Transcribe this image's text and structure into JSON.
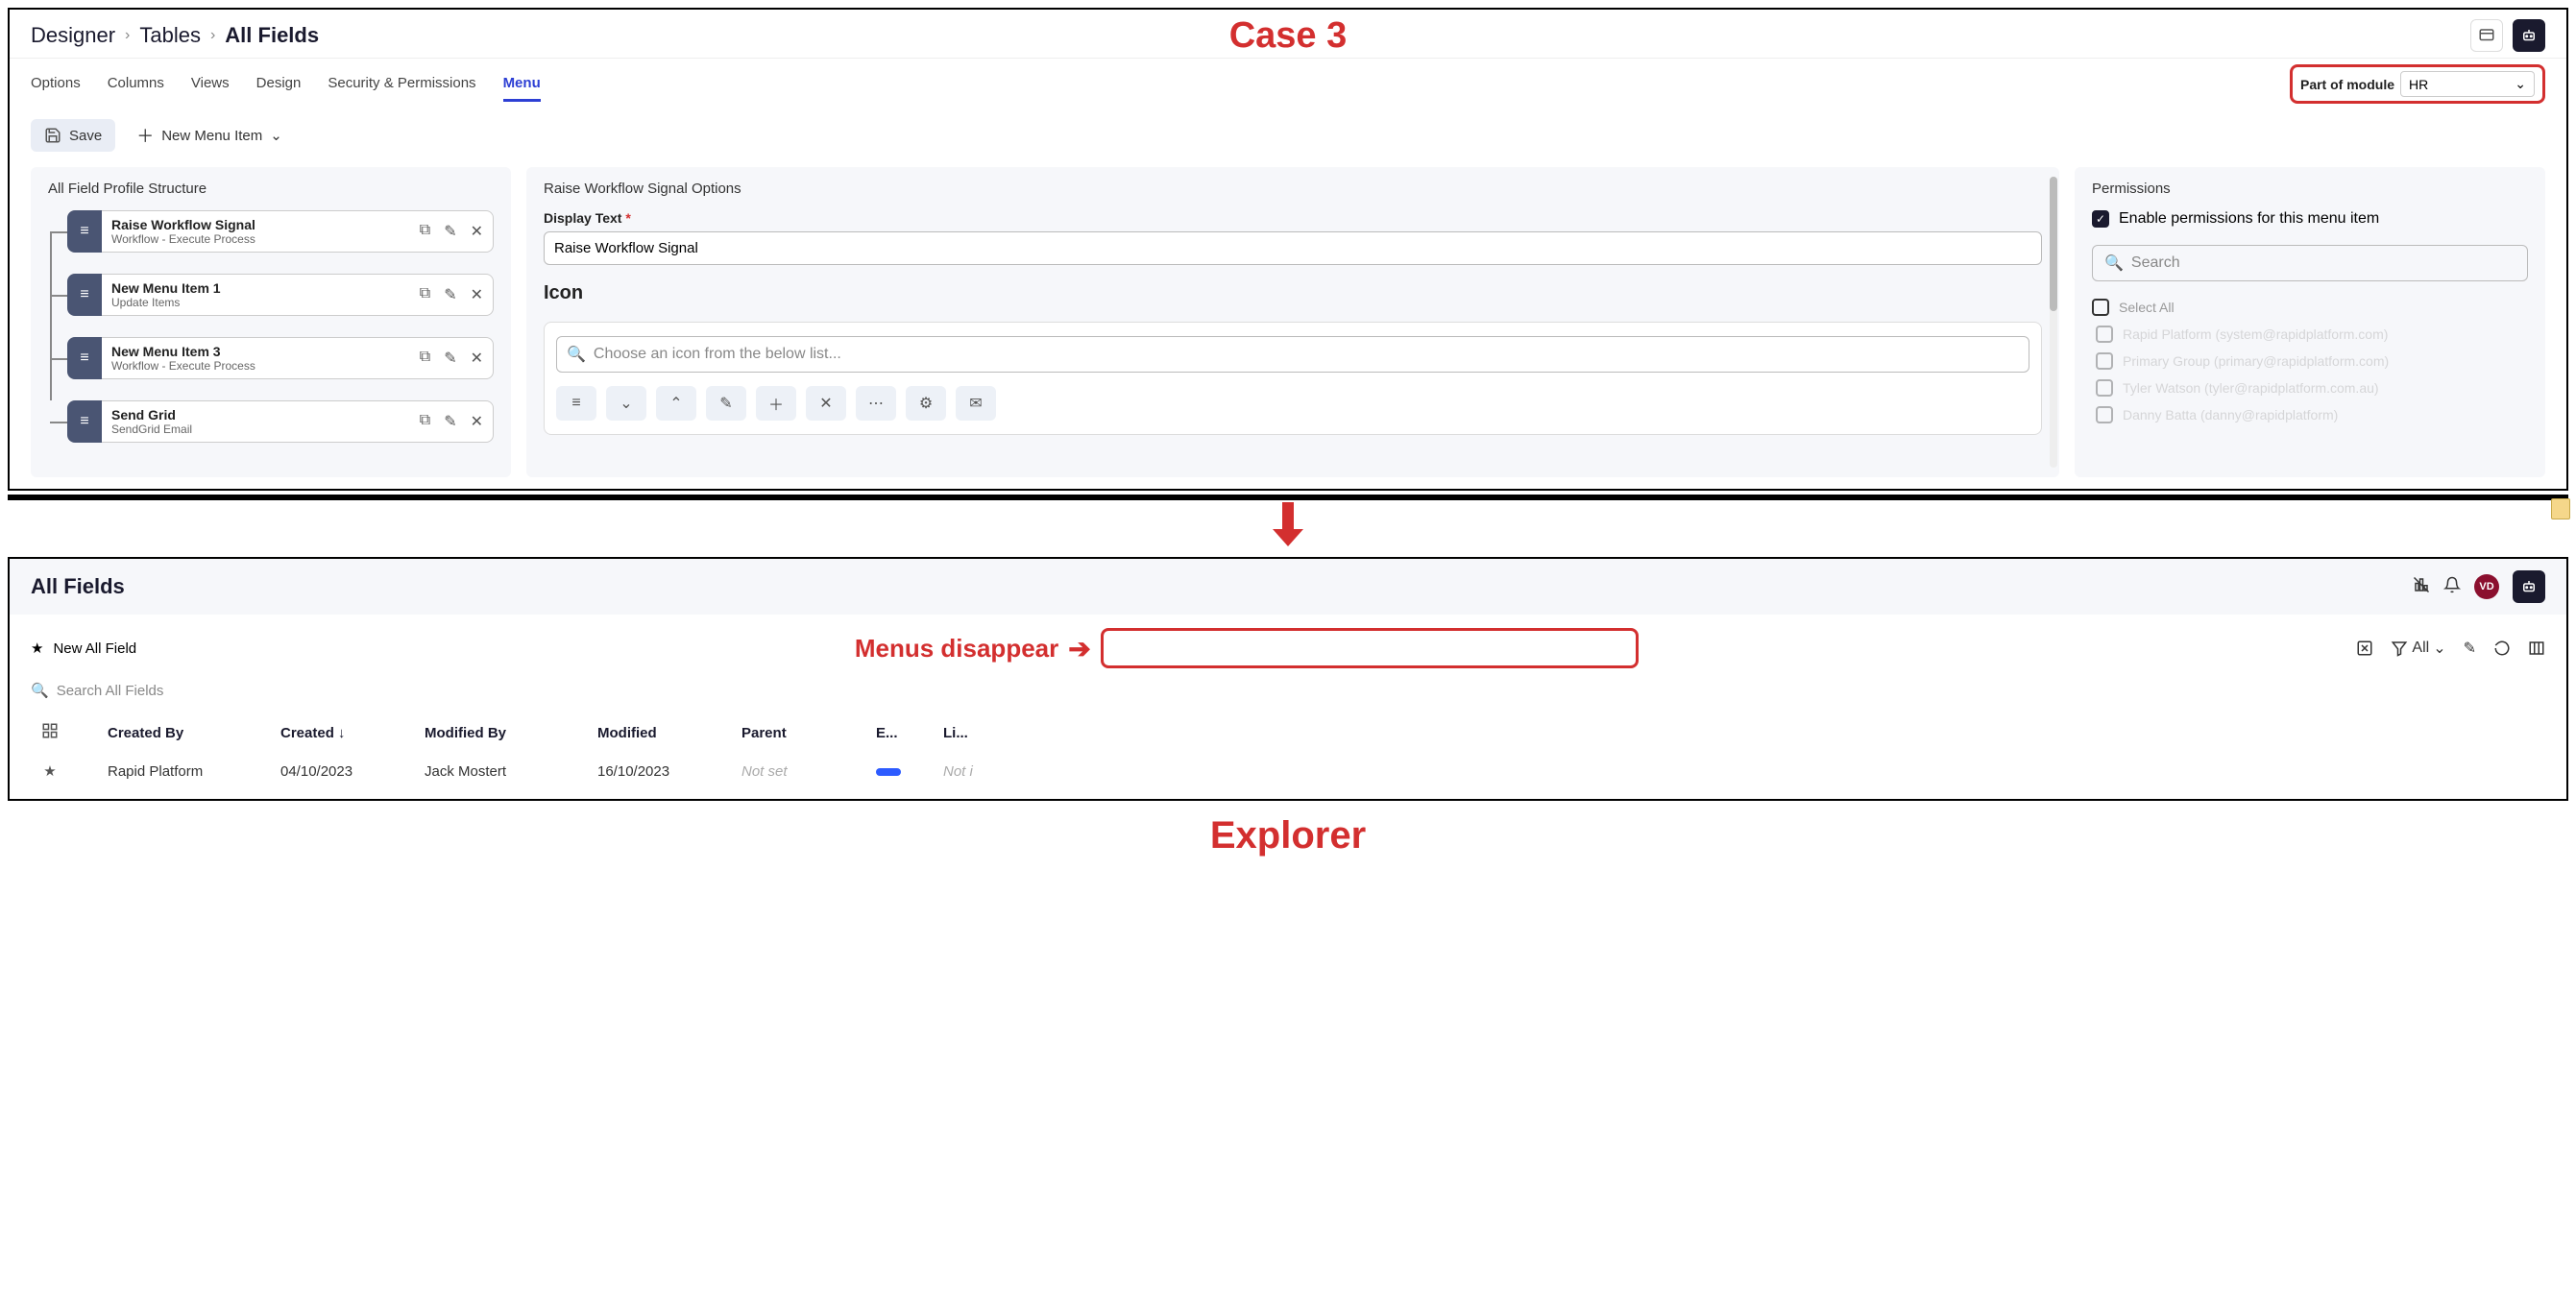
{
  "annotations": {
    "case_title": "Case 3",
    "menus_disappear": "Menus disappear",
    "explorer": "Explorer"
  },
  "designer": {
    "breadcrumb": [
      "Designer",
      "Tables",
      "All Fields"
    ],
    "tabs": [
      "Options",
      "Columns",
      "Views",
      "Design",
      "Security & Permissions",
      "Menu"
    ],
    "active_tab": "Menu",
    "module": {
      "label": "Part of module",
      "value": "HR"
    },
    "toolbar": {
      "save": "Save",
      "new_menu_item": "New Menu Item"
    },
    "left_panel": {
      "title": "All Field Profile Structure",
      "items": [
        {
          "title": "Raise Workflow Signal",
          "sub": "Workflow - Execute Process"
        },
        {
          "title": "New Menu Item 1",
          "sub": "Update Items"
        },
        {
          "title": "New Menu Item 3",
          "sub": "Workflow - Execute Process"
        },
        {
          "title": "Send Grid",
          "sub": "SendGrid Email"
        }
      ]
    },
    "mid_panel": {
      "title": "Raise Workflow Signal Options",
      "display_text_label": "Display Text",
      "display_text_value": "Raise Workflow Signal",
      "icon_heading": "Icon",
      "icon_search_placeholder": "Choose an icon from the below list..."
    },
    "right_panel": {
      "title": "Permissions",
      "enable_label": "Enable permissions for this menu item",
      "search_placeholder": "Search",
      "select_all": "Select All",
      "items": [
        "Rapid Platform (system@rapidplatform.com)",
        "Primary Group (primary@rapidplatform.com)",
        "Tyler Watson (tyler@rapidplatform.com.au)",
        "Danny Batta (danny@rapidplatform)"
      ]
    }
  },
  "explorer": {
    "title": "All Fields",
    "avatar": "VD",
    "new_btn": "New All Field",
    "search_placeholder": "Search All Fields",
    "filter_all": "All",
    "columns": {
      "created_by": "Created By",
      "created": "Created",
      "modified_by": "Modified By",
      "modified": "Modified",
      "parent": "Parent",
      "e": "E...",
      "li": "Li..."
    },
    "row": {
      "created_by": "Rapid Platform",
      "created": "04/10/2023",
      "modified_by": "Jack Mostert",
      "modified": "16/10/2023",
      "parent": "Not set",
      "li": "Not i"
    }
  }
}
